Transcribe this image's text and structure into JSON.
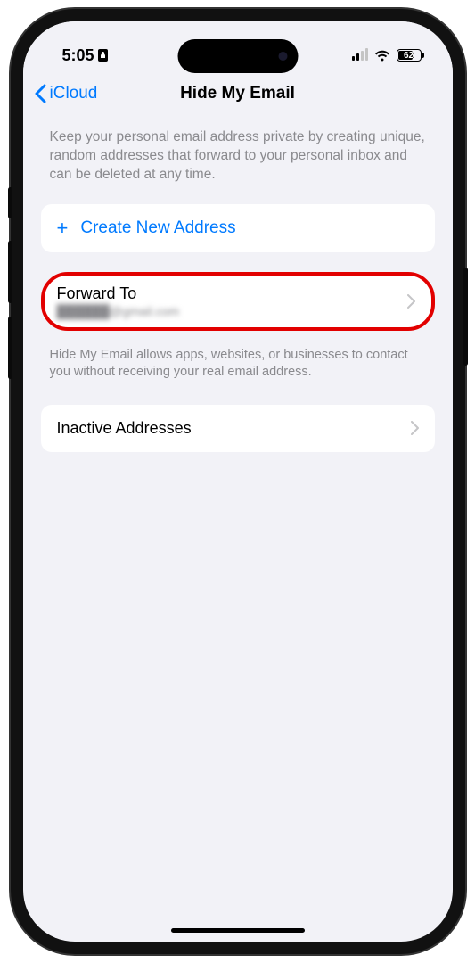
{
  "status": {
    "time": "5:05",
    "battery": "62"
  },
  "nav": {
    "back_label": "iCloud",
    "title": "Hide My Email"
  },
  "content": {
    "description": "Keep your personal email address private by creating unique, random addresses that forward to your personal inbox and can be deleted at any time.",
    "create_label": "Create New Address",
    "forward": {
      "title": "Forward To",
      "email": "██████@gmail.com"
    },
    "forward_footer": "Hide My Email allows apps, websites, or businesses to contact you without receiving your real email address.",
    "inactive_label": "Inactive Addresses"
  }
}
